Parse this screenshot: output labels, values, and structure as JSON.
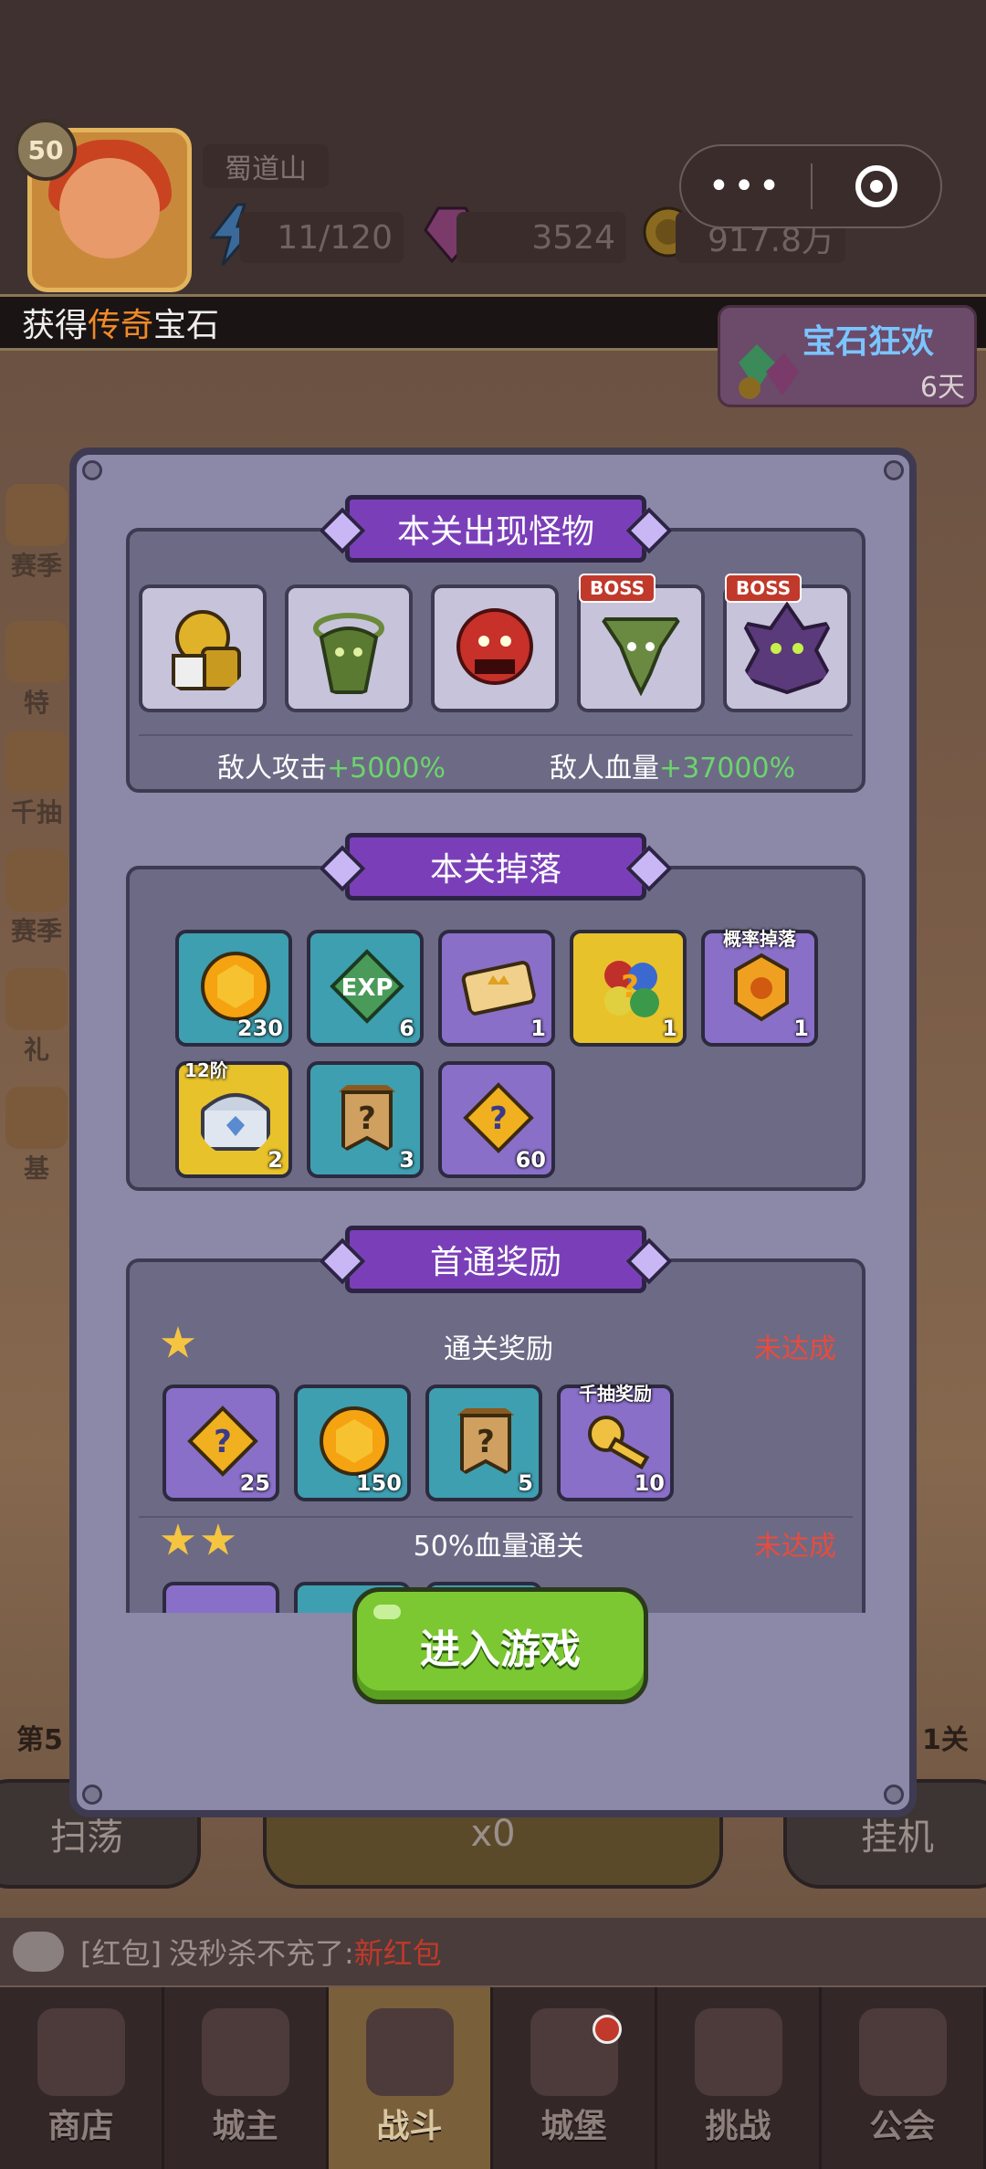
{
  "player": {
    "level": "50",
    "name": "蜀道山",
    "energy": "11/120",
    "gems": "3524",
    "gold": "917.8万"
  },
  "notice": {
    "prefix": "获得",
    "highlight": "传奇",
    "suffix": "宝石"
  },
  "event": {
    "title": "宝石狂欢",
    "days": "6天"
  },
  "side_menu": [
    "赛季",
    "特",
    "千抽",
    "赛季",
    "礼",
    "基"
  ],
  "stage_labels": {
    "left": "第5",
    "right": "1关"
  },
  "bottom_buttons": {
    "sweep": "扫荡",
    "center": "x0",
    "idle": "挂机"
  },
  "chat": {
    "tag": "[红包]",
    "text": "没秒杀不充了:",
    "highlight": "新红包"
  },
  "tabs": [
    {
      "label": "商店",
      "active": false
    },
    {
      "label": "城主",
      "active": false
    },
    {
      "label": "战斗",
      "active": true
    },
    {
      "label": "城堡",
      "active": false,
      "badge": true
    },
    {
      "label": "挑战",
      "active": false
    },
    {
      "label": "公会",
      "active": false
    }
  ],
  "dialog": {
    "monsters_title": "本关出现怪物",
    "monsters": [
      {
        "name": "golden-knight",
        "boss": false
      },
      {
        "name": "green-wraith",
        "boss": false
      },
      {
        "name": "red-ogre",
        "boss": false
      },
      {
        "name": "tornado-wraith",
        "boss": true
      },
      {
        "name": "purple-beast",
        "boss": true
      }
    ],
    "boss_label": "BOSS",
    "enemy_attack_label": "敌人攻击",
    "enemy_attack_value": "+5000%",
    "enemy_hp_label": "敌人血量",
    "enemy_hp_value": "+37000%",
    "drops_title": "本关掉落",
    "drops": [
      {
        "name": "gold-coin",
        "count": "230",
        "style": "teal",
        "tag": ""
      },
      {
        "name": "exp",
        "count": "6",
        "style": "teal",
        "tag": ""
      },
      {
        "name": "crown-ticket",
        "count": "1",
        "style": "purple",
        "tag": ""
      },
      {
        "name": "random-gem-bag",
        "count": "1",
        "style": "gold",
        "tag": ""
      },
      {
        "name": "orange-emblem",
        "count": "1",
        "style": "purple",
        "tag": "概率掉落"
      },
      {
        "name": "silver-chest",
        "count": "2",
        "style": "gold",
        "tag": "12阶"
      },
      {
        "name": "mystery-banner",
        "count": "3",
        "style": "teal",
        "tag": ""
      },
      {
        "name": "puzzle-piece",
        "count": "60",
        "style": "purple",
        "tag": ""
      }
    ],
    "first_clear_title": "首通奖励",
    "reward_rows": [
      {
        "title": "通关奖励",
        "status": "未达成",
        "stars": 1,
        "items": [
          {
            "name": "puzzle-piece",
            "count": "25",
            "style": "purple",
            "tag": ""
          },
          {
            "name": "gold-coin",
            "count": "150",
            "style": "teal",
            "tag": ""
          },
          {
            "name": "mystery-banner",
            "count": "5",
            "style": "teal",
            "tag": ""
          },
          {
            "name": "gold-key",
            "count": "10",
            "style": "purple",
            "tag": "千抽奖励"
          }
        ]
      },
      {
        "title": "50%血量通关",
        "status": "未达成",
        "stars": 2
      }
    ],
    "enter_button": "进入游戏"
  }
}
